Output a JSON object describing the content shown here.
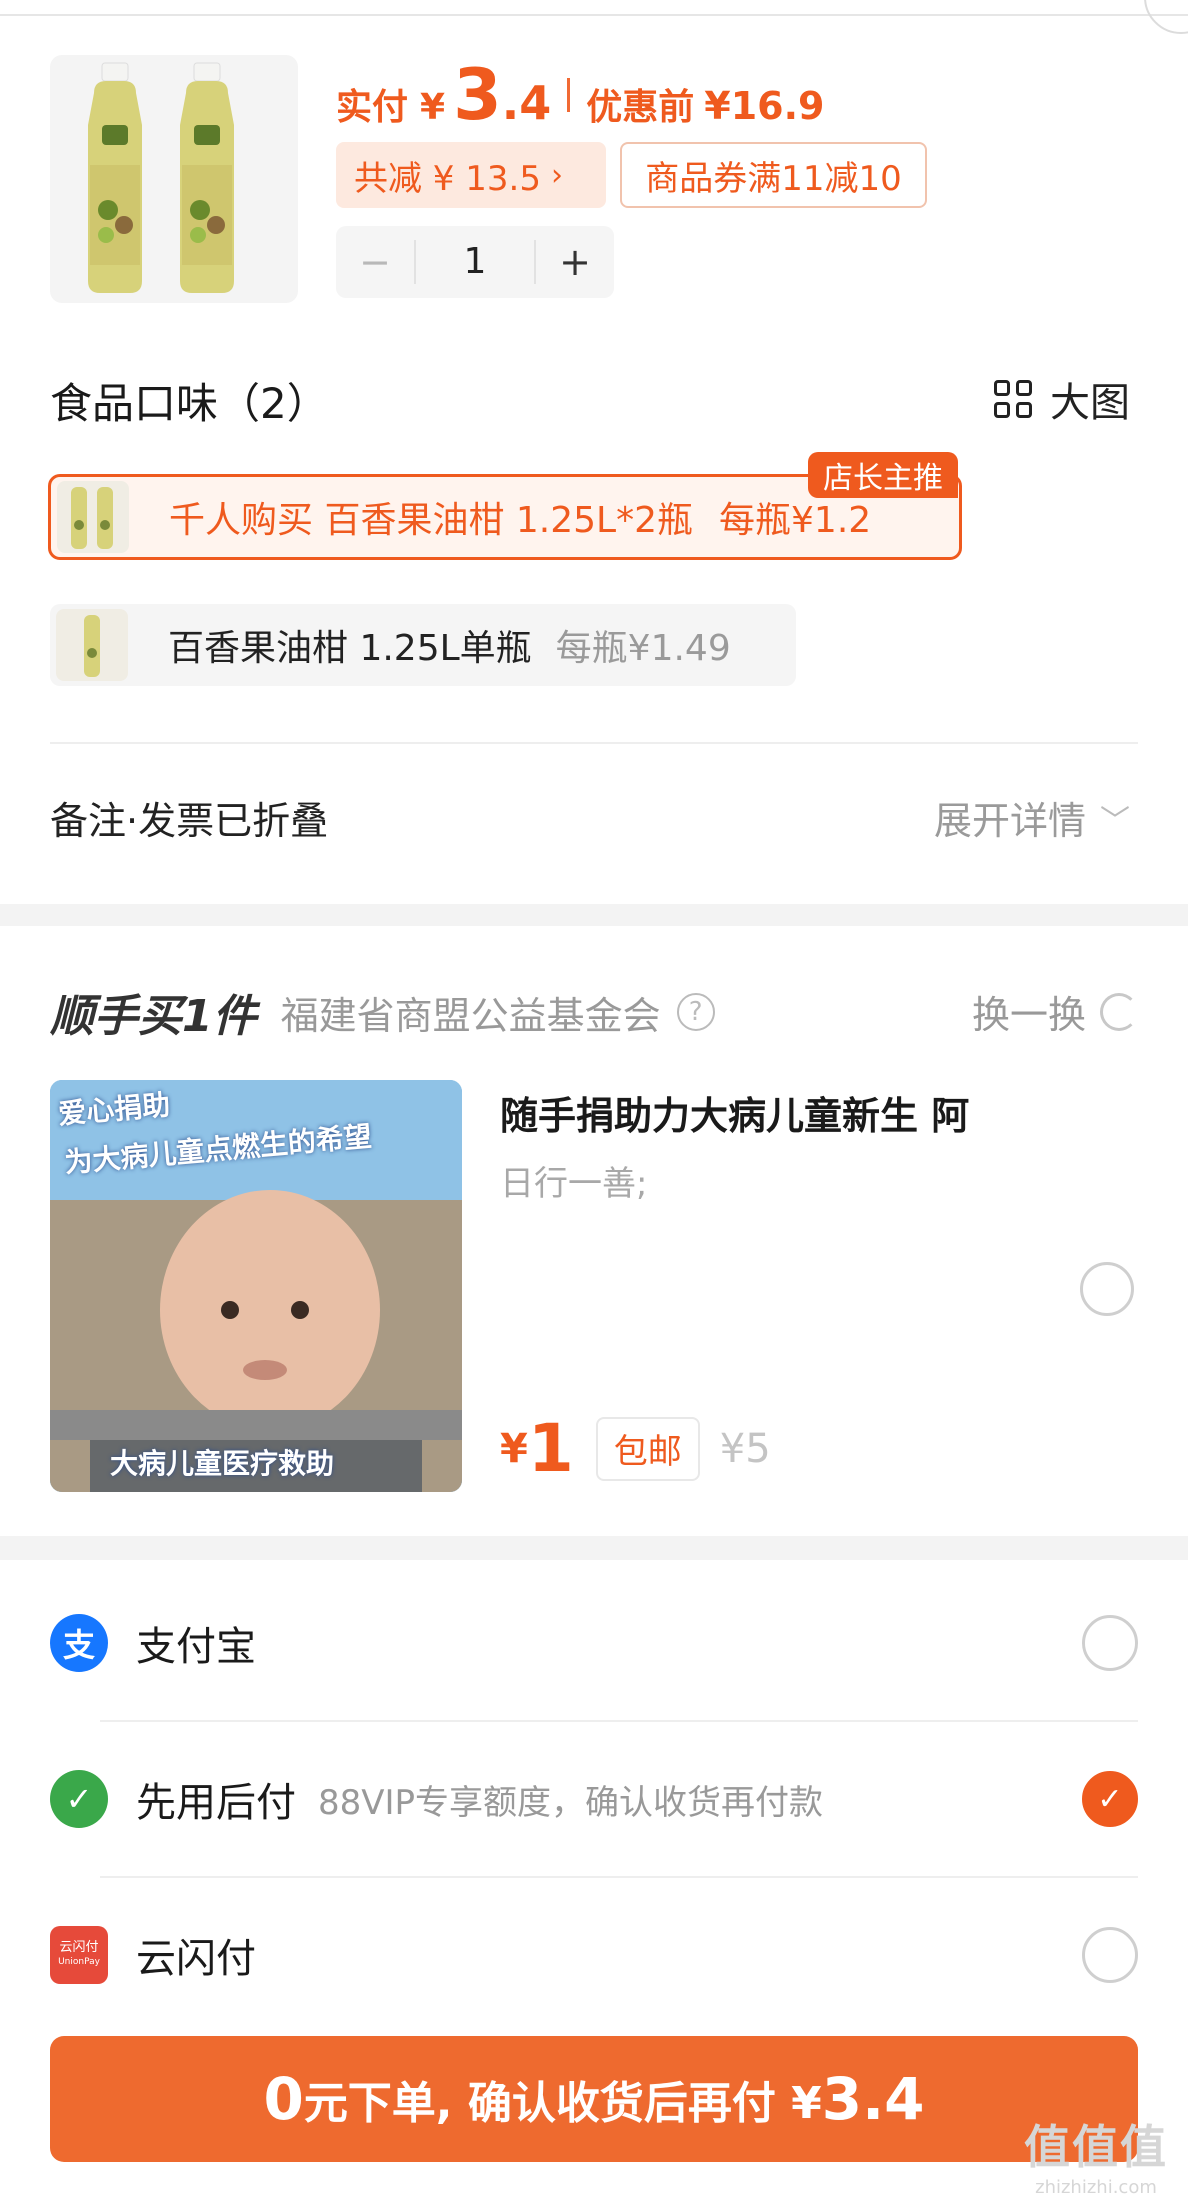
{
  "product": {
    "price_label": "实付",
    "price_yen": "¥",
    "price_int": "3",
    "price_dec": ".4",
    "orig_label": "优惠前",
    "orig_price": "¥16.9",
    "save_text": "共减 ¥ 13.5",
    "coupon_text": "商品券满11减10",
    "quantity": "1",
    "minus": "−",
    "plus": "+"
  },
  "flavor": {
    "title": "食品口味（2）",
    "bigpic_label": "大图",
    "options": [
      {
        "badge": "店长主推",
        "text": "千人购买  百香果油柑 1.25L*2瓶",
        "per": "每瓶¥1.2"
      },
      {
        "text": "百香果油柑 1.25L单瓶",
        "per": "每瓶¥1.49"
      }
    ]
  },
  "note": {
    "label": "备注·发票已折叠",
    "expand": "展开详情"
  },
  "donation": {
    "title": "顺手买1件",
    "org": "福建省商盟公益基金会",
    "swap": "换一换",
    "img_line1": "爱心捐助",
    "img_line2": "为大病儿童点燃生的希望",
    "img_bottom": "大病儿童医疗救助",
    "name": "随手捐助力大病儿童新生 阿",
    "desc": "日行一善;",
    "price_yen": "¥",
    "price": "1",
    "free_ship": "包邮",
    "orig_price": "¥5"
  },
  "payment": [
    {
      "label": "支付宝",
      "sub": "",
      "checked": false
    },
    {
      "label": "先用后付",
      "sub": "88VIP专享额度，确认收货再付款",
      "checked": true
    },
    {
      "label": "云闪付",
      "sub": "",
      "checked": false
    }
  ],
  "unionpay_logo": {
    "line1": "云闪付",
    "line2": "UnionPay"
  },
  "submit": {
    "zero": "0",
    "text": "元下单, 确认收货后再付 ¥",
    "amount": "3.4"
  },
  "watermark": {
    "logo": "值值值",
    "url": "zhizhizhi.com"
  },
  "colors": {
    "accent": "#ef5a1e",
    "submit_bg": "#ee6a2f",
    "alipay": "#1677ff",
    "bnpl": "#3aa84a"
  }
}
